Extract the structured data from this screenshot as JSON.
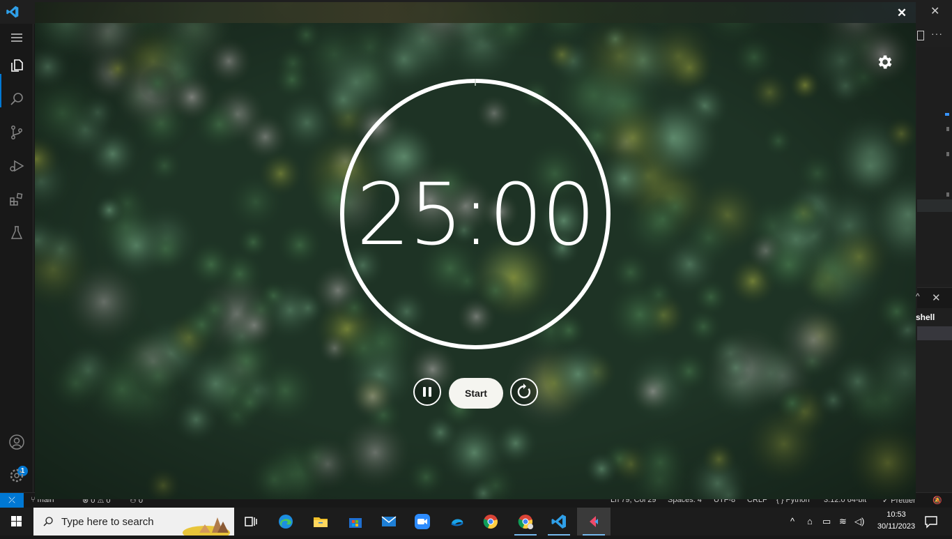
{
  "overlay": {
    "close_glyph": "✕"
  },
  "timer": {
    "display": "25:00",
    "progress": 0.0,
    "start_label": "Start"
  },
  "statusbar": {
    "branch": "main",
    "problems": "⊗ 0 ⚠ 0",
    "ports": "⚇ 0",
    "cursor": "Ln 79, Col 29",
    "spaces": "Spaces: 4",
    "encoding": "UTF-8",
    "eol": "CRLF",
    "language": "{ } Python",
    "interpreter": "3.12.0 64-bit",
    "formatter": "✓ Prettier"
  },
  "activity": {
    "account_badge": "1"
  },
  "panel": {
    "terminal_label": "shell"
  },
  "taskbar": {
    "search_placeholder": "Type here to search",
    "clock_time": "10:53",
    "clock_date": "30/11/2023",
    "apps": [
      "task-view",
      "edge",
      "file-explorer",
      "microsoft-store",
      "mail",
      "zoom",
      "onedrive-like",
      "chrome",
      "chrome-profile",
      "vscode",
      "pomodoro-app"
    ]
  },
  "colors": {
    "accent": "#0078d4",
    "timer_ring": "#ffffff",
    "start_button_bg": "#f5f5f0"
  }
}
